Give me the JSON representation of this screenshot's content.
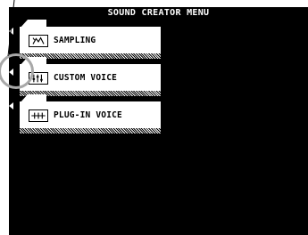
{
  "screen": {
    "title": "SOUND CREATOR MENU"
  },
  "menu": {
    "items": [
      {
        "label": "SAMPLING",
        "icon": "sampling-icon"
      },
      {
        "label": "CUSTOM VOICE",
        "icon": "custom-voice-icon"
      },
      {
        "label": "PLUG-IN VOICE",
        "icon": "plug-in-voice-icon"
      }
    ]
  },
  "colors": {
    "screen_bg": "#000000",
    "tab_bg": "#ffffff",
    "callout": "#a8a8a8"
  }
}
